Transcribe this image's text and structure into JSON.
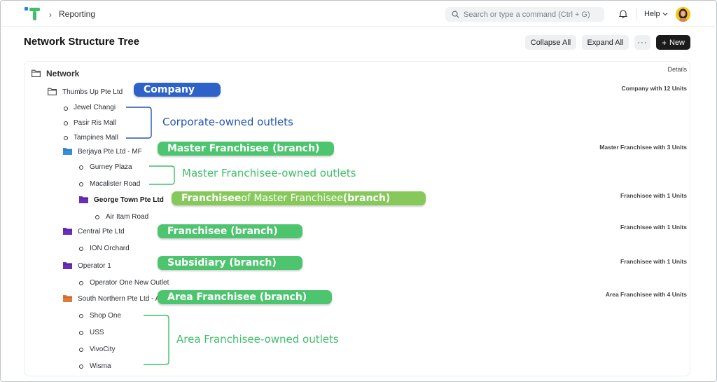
{
  "navbar": {
    "breadcrumb": "Reporting",
    "search_placeholder": "Search or type a command (Ctrl + G)",
    "help_label": "Help"
  },
  "page": {
    "title": "Network Structure Tree",
    "collapse_label": "Collapse All",
    "expand_label": "Expand All",
    "more_label": "···",
    "new_label": "New"
  },
  "tree": {
    "details_header": "Details",
    "root": "Network",
    "company": {
      "label": "Thumbs Up Pte Ltd",
      "detail": "Company with 12 Units"
    },
    "corporate_outlets": [
      "Jewel Changi",
      "Pasir Ris Mall",
      "Tampines Mall"
    ],
    "master_franchisee": {
      "label": "Berjaya Pte Ltd - MF",
      "detail": "Master Franchisee with 3 Units",
      "color": "#3b8fd6"
    },
    "master_outlets": [
      "Gurney Plaza",
      "Macalister Road"
    ],
    "sub_franchisee": {
      "label": "George Town Pte Ltd",
      "detail": "Franchisee with 1 Units",
      "color": "#6a2fb8"
    },
    "sub_franchisee_outlets": [
      "Air Itam Road"
    ],
    "franchisee": {
      "label": "Central Pte Ltd",
      "detail": "Franchisee with 1 Units",
      "color": "#6a2fb8"
    },
    "franchisee_outlets": [
      "ION Orchard"
    ],
    "subsidiary": {
      "label": "Operator 1",
      "detail": "Franchisee with 1 Units",
      "color": "#6a2fb8"
    },
    "subsidiary_outlets": [
      "Operator One New Outlet"
    ],
    "area_franchisee": {
      "label": "South Northern Pte Ltd - AF",
      "detail": "Area Franchisee with 4 Units",
      "color": "#e07a3c"
    },
    "area_outlets": [
      "Shop One",
      "USS",
      "VivoCity",
      "Wisma"
    ]
  },
  "annotations": {
    "company": "Company",
    "corporate": "Corporate-owned outlets",
    "master_franchisee_bold": "Master Franchisee",
    "master_franchisee_rest": "(branch)",
    "master_owned": "Master Franchisee-owned outlets",
    "fof_bold1": "Franchisee",
    "fof_mid": " of Master Franchisee ",
    "fof_bold2": "(branch)",
    "franchisee": "Franchisee (branch)",
    "subsidiary": "Subsidiary (branch)",
    "area_franchisee": "Area Franchisee (branch)",
    "area_owned": "Area Franchisee-owned outlets"
  },
  "colors": {
    "accent_blue": "#2d63c8",
    "accent_green": "#4dc46e",
    "accent_lime": "#86c95a",
    "new_button": "#1b1b1b"
  }
}
